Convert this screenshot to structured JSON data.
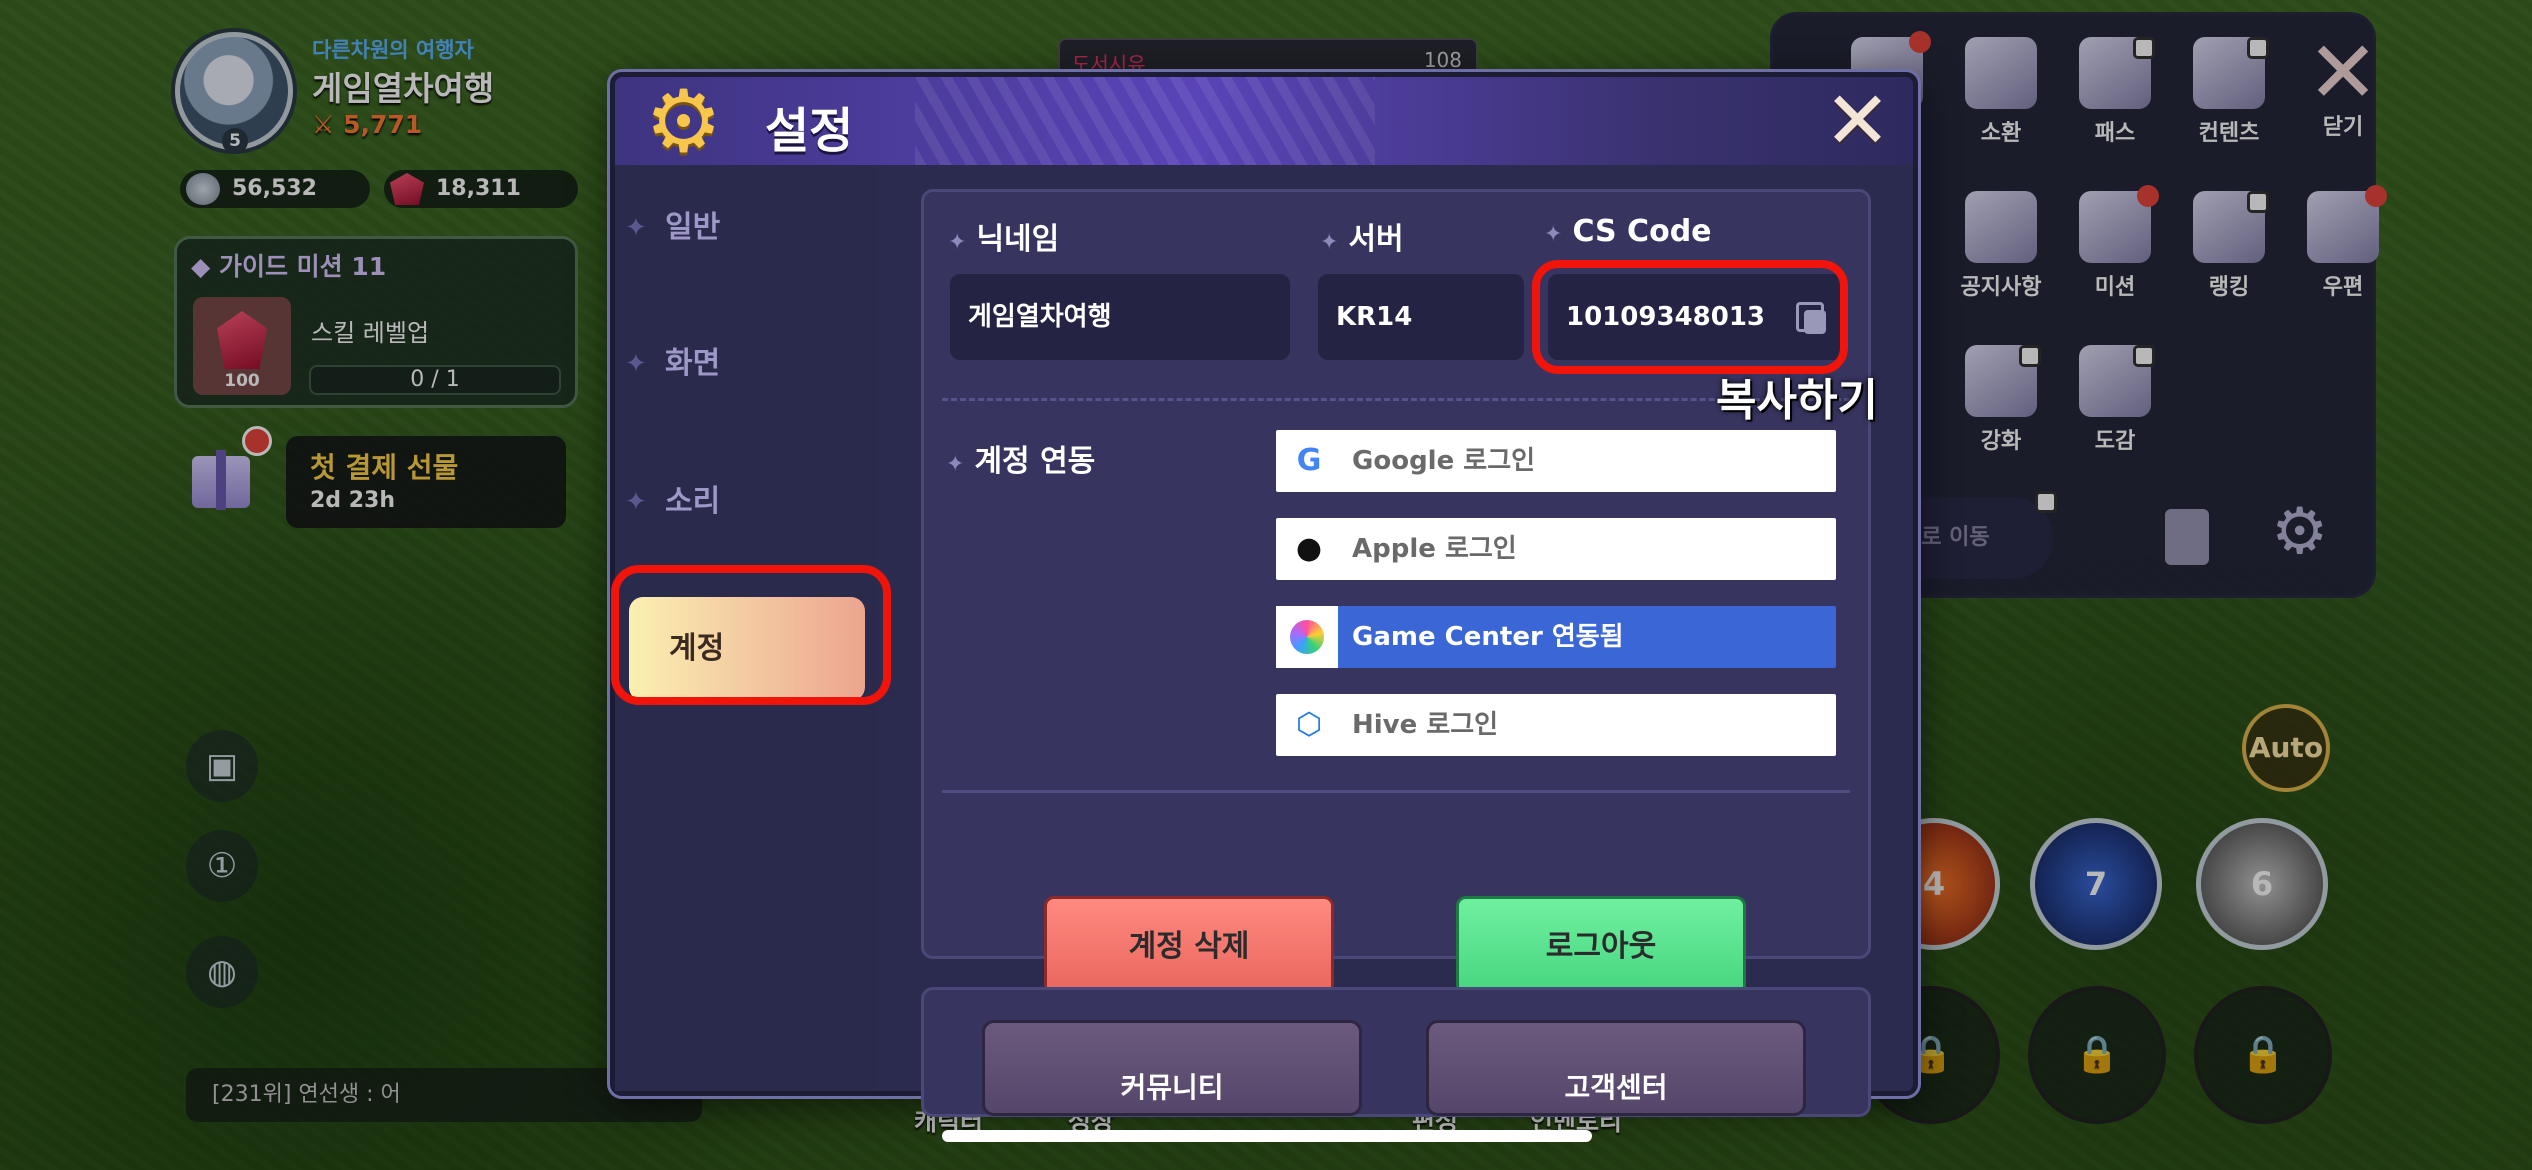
{
  "player": {
    "title": "다른차원의 여행자",
    "name": "게임열차여행",
    "level": "5",
    "power": "5,771",
    "silver": "56,532",
    "gems": "18,311"
  },
  "guide": {
    "title": "가이드 미션 11",
    "task": "스킬 레벨업",
    "reward_count": "100",
    "progress_text": "0 / 1",
    "progress": 0
  },
  "first_payment": {
    "title": "첫 결제 선물",
    "timer": "2d 23h"
  },
  "chat": {
    "text": "[231위] 연선생 : 어"
  },
  "top_bar": {
    "label": "도서시유",
    "value": "108"
  },
  "right_menu": {
    "items": [
      {
        "label": "소환",
        "icon": "summon-icon"
      },
      {
        "label": "패스",
        "icon": "pass-icon"
      },
      {
        "label": "컨텐츠",
        "icon": "contents-icon"
      },
      {
        "label": "닫기",
        "icon": "close-icon"
      },
      {
        "label": "공지사항",
        "icon": "megaphone-icon"
      },
      {
        "label": "미션",
        "icon": "mission-icon"
      },
      {
        "label": "랭킹",
        "icon": "trophy-icon"
      },
      {
        "label": "우편",
        "icon": "mail-icon"
      },
      {
        "label": "강화",
        "icon": "hammer-icon"
      },
      {
        "label": "도감",
        "icon": "book-icon"
      }
    ],
    "move_label": "터로 이동"
  },
  "combat": {
    "auto_label": "Auto",
    "skills": [
      "4",
      "7",
      "6"
    ]
  },
  "bottom_tabs": [
    "캐릭터",
    "성장",
    "편성",
    "인벤토리"
  ],
  "settings": {
    "title": "설정",
    "close": "✕",
    "tabs": [
      {
        "label": "일반",
        "active": false
      },
      {
        "label": "화면",
        "active": false
      },
      {
        "label": "소리",
        "active": false
      },
      {
        "label": "계정",
        "active": true
      }
    ],
    "nickname_label": "닉네임",
    "nickname_value": "게임열차여행",
    "server_label": "서버",
    "server_value": "KR14",
    "cs_label": "CS Code",
    "cs_value": "10109348013",
    "copy_annotation": "복사하기",
    "link_label": "계정 연동",
    "logins": [
      {
        "label": "Google 로그인",
        "icon": "google-icon",
        "linked": false
      },
      {
        "label": "Apple 로그인",
        "icon": "apple-icon",
        "linked": false
      },
      {
        "label": "Game Center 연동됨",
        "icon": "game-center-icon",
        "linked": true
      },
      {
        "label": "Hive 로그인",
        "icon": "hive-icon",
        "linked": false
      }
    ],
    "delete_label": "계정 삭제",
    "logout_label": "로그아웃",
    "community_label": "커뮤니티",
    "support_label": "고객센터"
  },
  "colors": {
    "dialog_bg": "#2b2b4f",
    "active_tab": "#f3c6a0",
    "highlight": "#f0140a",
    "delete": "#e8645c",
    "logout": "#45d47e",
    "game_center": "#3a66d6"
  }
}
